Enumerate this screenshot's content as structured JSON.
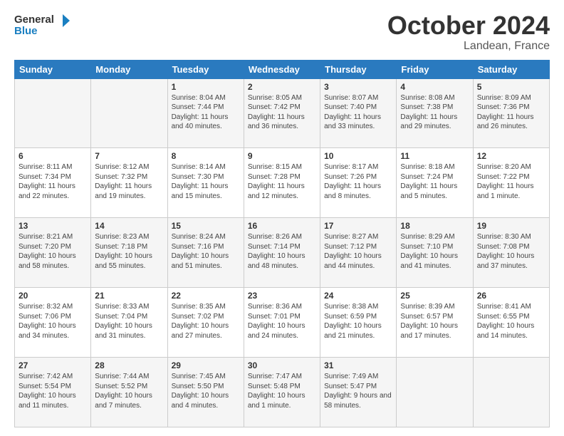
{
  "header": {
    "logo_line1": "General",
    "logo_line2": "Blue",
    "month_title": "October 2024",
    "location": "Landean, France"
  },
  "days_of_week": [
    "Sunday",
    "Monday",
    "Tuesday",
    "Wednesday",
    "Thursday",
    "Friday",
    "Saturday"
  ],
  "weeks": [
    [
      {
        "day": "",
        "info": ""
      },
      {
        "day": "",
        "info": ""
      },
      {
        "day": "1",
        "info": "Sunrise: 8:04 AM\nSunset: 7:44 PM\nDaylight: 11 hours and 40 minutes."
      },
      {
        "day": "2",
        "info": "Sunrise: 8:05 AM\nSunset: 7:42 PM\nDaylight: 11 hours and 36 minutes."
      },
      {
        "day": "3",
        "info": "Sunrise: 8:07 AM\nSunset: 7:40 PM\nDaylight: 11 hours and 33 minutes."
      },
      {
        "day": "4",
        "info": "Sunrise: 8:08 AM\nSunset: 7:38 PM\nDaylight: 11 hours and 29 minutes."
      },
      {
        "day": "5",
        "info": "Sunrise: 8:09 AM\nSunset: 7:36 PM\nDaylight: 11 hours and 26 minutes."
      }
    ],
    [
      {
        "day": "6",
        "info": "Sunrise: 8:11 AM\nSunset: 7:34 PM\nDaylight: 11 hours and 22 minutes."
      },
      {
        "day": "7",
        "info": "Sunrise: 8:12 AM\nSunset: 7:32 PM\nDaylight: 11 hours and 19 minutes."
      },
      {
        "day": "8",
        "info": "Sunrise: 8:14 AM\nSunset: 7:30 PM\nDaylight: 11 hours and 15 minutes."
      },
      {
        "day": "9",
        "info": "Sunrise: 8:15 AM\nSunset: 7:28 PM\nDaylight: 11 hours and 12 minutes."
      },
      {
        "day": "10",
        "info": "Sunrise: 8:17 AM\nSunset: 7:26 PM\nDaylight: 11 hours and 8 minutes."
      },
      {
        "day": "11",
        "info": "Sunrise: 8:18 AM\nSunset: 7:24 PM\nDaylight: 11 hours and 5 minutes."
      },
      {
        "day": "12",
        "info": "Sunrise: 8:20 AM\nSunset: 7:22 PM\nDaylight: 11 hours and 1 minute."
      }
    ],
    [
      {
        "day": "13",
        "info": "Sunrise: 8:21 AM\nSunset: 7:20 PM\nDaylight: 10 hours and 58 minutes."
      },
      {
        "day": "14",
        "info": "Sunrise: 8:23 AM\nSunset: 7:18 PM\nDaylight: 10 hours and 55 minutes."
      },
      {
        "day": "15",
        "info": "Sunrise: 8:24 AM\nSunset: 7:16 PM\nDaylight: 10 hours and 51 minutes."
      },
      {
        "day": "16",
        "info": "Sunrise: 8:26 AM\nSunset: 7:14 PM\nDaylight: 10 hours and 48 minutes."
      },
      {
        "day": "17",
        "info": "Sunrise: 8:27 AM\nSunset: 7:12 PM\nDaylight: 10 hours and 44 minutes."
      },
      {
        "day": "18",
        "info": "Sunrise: 8:29 AM\nSunset: 7:10 PM\nDaylight: 10 hours and 41 minutes."
      },
      {
        "day": "19",
        "info": "Sunrise: 8:30 AM\nSunset: 7:08 PM\nDaylight: 10 hours and 37 minutes."
      }
    ],
    [
      {
        "day": "20",
        "info": "Sunrise: 8:32 AM\nSunset: 7:06 PM\nDaylight: 10 hours and 34 minutes."
      },
      {
        "day": "21",
        "info": "Sunrise: 8:33 AM\nSunset: 7:04 PM\nDaylight: 10 hours and 31 minutes."
      },
      {
        "day": "22",
        "info": "Sunrise: 8:35 AM\nSunset: 7:02 PM\nDaylight: 10 hours and 27 minutes."
      },
      {
        "day": "23",
        "info": "Sunrise: 8:36 AM\nSunset: 7:01 PM\nDaylight: 10 hours and 24 minutes."
      },
      {
        "day": "24",
        "info": "Sunrise: 8:38 AM\nSunset: 6:59 PM\nDaylight: 10 hours and 21 minutes."
      },
      {
        "day": "25",
        "info": "Sunrise: 8:39 AM\nSunset: 6:57 PM\nDaylight: 10 hours and 17 minutes."
      },
      {
        "day": "26",
        "info": "Sunrise: 8:41 AM\nSunset: 6:55 PM\nDaylight: 10 hours and 14 minutes."
      }
    ],
    [
      {
        "day": "27",
        "info": "Sunrise: 7:42 AM\nSunset: 5:54 PM\nDaylight: 10 hours and 11 minutes."
      },
      {
        "day": "28",
        "info": "Sunrise: 7:44 AM\nSunset: 5:52 PM\nDaylight: 10 hours and 7 minutes."
      },
      {
        "day": "29",
        "info": "Sunrise: 7:45 AM\nSunset: 5:50 PM\nDaylight: 10 hours and 4 minutes."
      },
      {
        "day": "30",
        "info": "Sunrise: 7:47 AM\nSunset: 5:48 PM\nDaylight: 10 hours and 1 minute."
      },
      {
        "day": "31",
        "info": "Sunrise: 7:49 AM\nSunset: 5:47 PM\nDaylight: 9 hours and 58 minutes."
      },
      {
        "day": "",
        "info": ""
      },
      {
        "day": "",
        "info": ""
      }
    ]
  ]
}
